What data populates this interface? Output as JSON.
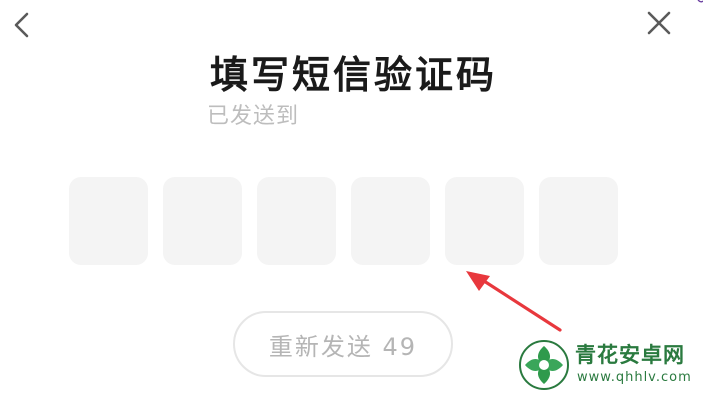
{
  "header": {
    "back_icon": "chevron-left-icon",
    "close_icon": "close-icon",
    "title": "填写短信验证码"
  },
  "verification": {
    "sent_prefix": "已发送到",
    "code_length": 6
  },
  "resend": {
    "label": "重新发送 49"
  },
  "watermark": {
    "name": "青花安卓网",
    "url": "www.qhhlv.com",
    "brand_color": "#2a7a3f"
  },
  "annotation": {
    "icon": "red-arrow-icon",
    "color": "#e8383d"
  }
}
